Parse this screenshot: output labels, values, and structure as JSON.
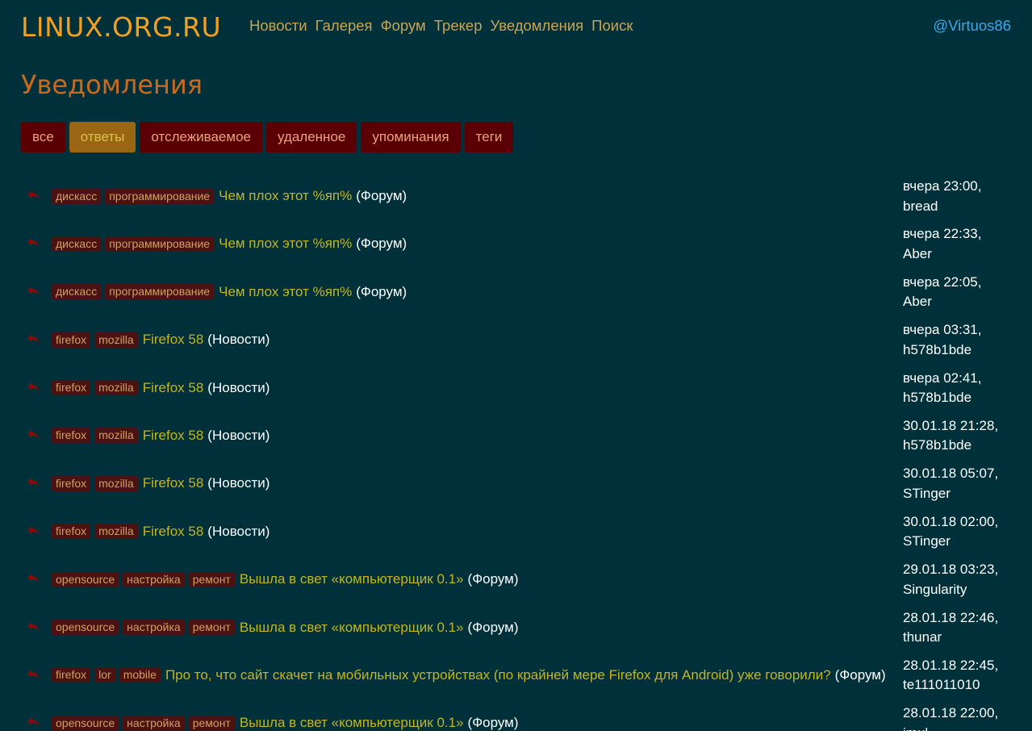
{
  "header": {
    "logo": "LINUX.ORG.RU",
    "nav": [
      "Новости",
      "Галерея",
      "Форум",
      "Трекер",
      "Уведомления",
      "Поиск"
    ],
    "user": "@Virtuos86"
  },
  "page_title": "Уведомления",
  "tabs": [
    {
      "label": "все",
      "active": false
    },
    {
      "label": "ответы",
      "active": true
    },
    {
      "label": "отслеживаемое",
      "active": false
    },
    {
      "label": "удаленное",
      "active": false
    },
    {
      "label": "упоминания",
      "active": false
    },
    {
      "label": "теги",
      "active": false
    }
  ],
  "colors": {
    "background": "#00313a",
    "logo": "#f3a021",
    "nav": "#c7a458",
    "user": "#3da7ea",
    "title": "#c96a1e",
    "tab_bg": "#5a0004",
    "tab_active_bg": "#9a6614",
    "tag_bg": "#4a1212",
    "link": "#c2b524",
    "reply_icon": "#8a0a0a"
  },
  "icons": {
    "reply": "reply-arrow-icon"
  },
  "notifications": [
    {
      "tags": [
        "дискасс",
        "программирование"
      ],
      "title": "Чем плох этот %яп%",
      "section": "(Форум)",
      "time": "вчера 23:00,",
      "author": "bread"
    },
    {
      "tags": [
        "дискасс",
        "программирование"
      ],
      "title": "Чем плох этот %яп%",
      "section": "(Форум)",
      "time": "вчера 22:33,",
      "author": "Aber"
    },
    {
      "tags": [
        "дискасс",
        "программирование"
      ],
      "title": "Чем плох этот %яп%",
      "section": "(Форум)",
      "time": "вчера 22:05,",
      "author": "Aber"
    },
    {
      "tags": [
        "firefox",
        "mozilla"
      ],
      "title": "Firefox 58",
      "section": "(Новости)",
      "time": "вчера 03:31,",
      "author": "h578b1bde"
    },
    {
      "tags": [
        "firefox",
        "mozilla"
      ],
      "title": "Firefox 58",
      "section": "(Новости)",
      "time": "вчера 02:41,",
      "author": "h578b1bde"
    },
    {
      "tags": [
        "firefox",
        "mozilla"
      ],
      "title": "Firefox 58",
      "section": "(Новости)",
      "time": "30.01.18 21:28,",
      "author": "h578b1bde"
    },
    {
      "tags": [
        "firefox",
        "mozilla"
      ],
      "title": "Firefox 58",
      "section": "(Новости)",
      "time": "30.01.18 05:07,",
      "author": "STinger"
    },
    {
      "tags": [
        "firefox",
        "mozilla"
      ],
      "title": "Firefox 58",
      "section": "(Новости)",
      "time": "30.01.18 02:00,",
      "author": "STinger"
    },
    {
      "tags": [
        "opensource",
        "настройка",
        "ремонт"
      ],
      "title": "Вышла в свет «компьютерщик 0.1»",
      "section": "(Форум)",
      "time": "29.01.18 03:23,",
      "author": "Singularity"
    },
    {
      "tags": [
        "opensource",
        "настройка",
        "ремонт"
      ],
      "title": "Вышла в свет «компьютерщик 0.1»",
      "section": "(Форум)",
      "time": "28.01.18 22:46,",
      "author": "thunar"
    },
    {
      "tags": [
        "firefox",
        "lor",
        "mobile"
      ],
      "title": "Про то, что сайт скачет на мобильных устройствах (по крайней мере Firefox для Android) уже говорили?",
      "section": "(Форум)",
      "time": "28.01.18 22:45,",
      "author": "te111011010"
    },
    {
      "tags": [
        "opensource",
        "настройка",
        "ремонт"
      ],
      "title": "Вышла в свет «компьютерщик 0.1»",
      "section": "(Форум)",
      "time": "28.01.18 22:00,",
      "author": "imul"
    }
  ]
}
